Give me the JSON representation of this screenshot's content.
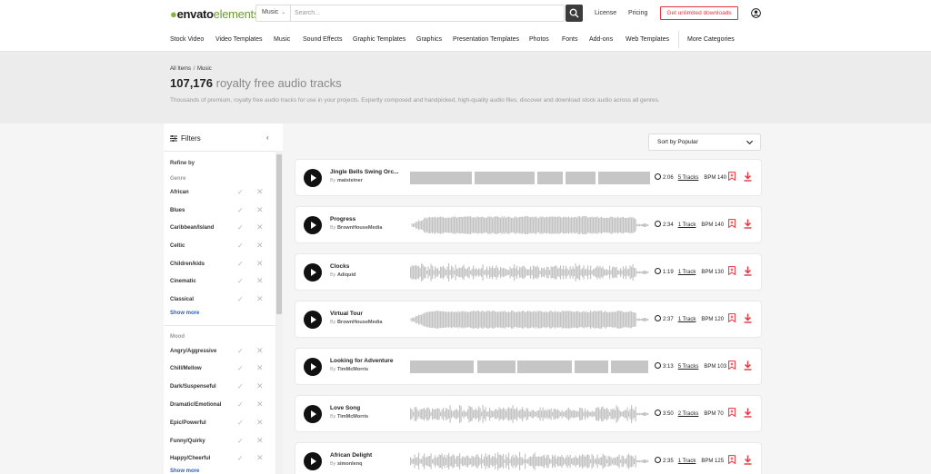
{
  "brand": {
    "part1": "envato",
    "part2": "elements",
    "accent": "#82b541"
  },
  "search": {
    "category": "Music",
    "placeholder": "Search..."
  },
  "header_links": {
    "license": "License",
    "pricing": "Pricing",
    "cta": "Get unlimited downloads"
  },
  "categories": [
    "Stock Video",
    "Video Templates",
    "Music",
    "Sound Effects",
    "Graphic Templates",
    "Graphics",
    "Presentation Templates",
    "Photos",
    "Fonts",
    "Add-ons",
    "Web Templates",
    "More Categories"
  ],
  "breadcrumb": {
    "root": "All Items",
    "sep": "/",
    "current": "Music"
  },
  "hero": {
    "count": "107,176",
    "title_rest": "royalty free audio tracks",
    "description": "Thousands of premium, royalty free audio tracks for use in your projects. Expertly composed and handpicked, high-quality audio files, discover and download stock audio across all genres."
  },
  "filters": {
    "title": "Filters",
    "refine_by": "Refine by",
    "genre": {
      "title": "Genre",
      "items": [
        "African",
        "Blues",
        "Caribbean/Island",
        "Celtic",
        "Children/kids",
        "Cinematic",
        "Classical"
      ],
      "show_more": "Show more"
    },
    "mood": {
      "title": "Mood",
      "items": [
        "Angry/Aggressive",
        "Chill/Mellow",
        "Dark/Suspenseful",
        "Dramatic/Emotional",
        "Epic/Powerful",
        "Funny/Quirky",
        "Happy/Cheerful"
      ],
      "show_more": "Show more"
    }
  },
  "sort": {
    "label": "Sort by Popular"
  },
  "tracks": [
    {
      "title": "Jingle Bells Swing Orc...",
      "by": "By",
      "author": "matsteiner",
      "duration": "2:06",
      "tracks": "5 Tracks",
      "bpm": "BPM 140"
    },
    {
      "title": "Progress",
      "by": "By",
      "author": "BrownHouseMedia",
      "duration": "2:34",
      "tracks": "1 Track",
      "bpm": "BPM 140"
    },
    {
      "title": "Clocks",
      "by": "By",
      "author": "Adiquid",
      "duration": "1:19",
      "tracks": "1 Track",
      "bpm": "BPM 130"
    },
    {
      "title": "Virtual Tour",
      "by": "By",
      "author": "BrownHouseMedia",
      "duration": "2:37",
      "tracks": "1 Track",
      "bpm": "BPM 120"
    },
    {
      "title": "Looking for Adventure",
      "by": "By",
      "author": "TimMcMorris",
      "duration": "3:13",
      "tracks": "5 Tracks",
      "bpm": "BPM 103"
    },
    {
      "title": "Love Song",
      "by": "By",
      "author": "TimMcMorris",
      "duration": "3:50",
      "tracks": "2 Tracks",
      "bpm": "BPM 70"
    },
    {
      "title": "African Delight",
      "by": "By",
      "author": "simonlenq",
      "duration": "2:35",
      "tracks": "1 Track",
      "bpm": "BPM 125"
    }
  ]
}
